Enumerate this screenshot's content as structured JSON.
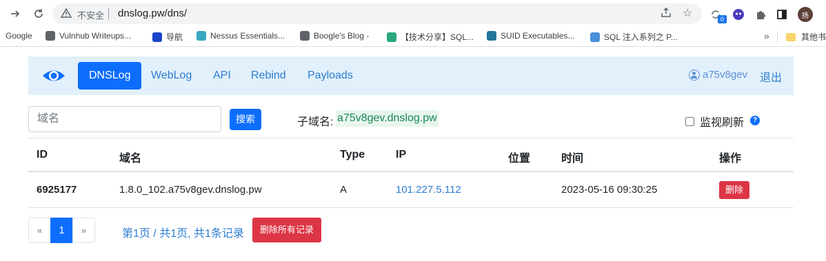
{
  "browser": {
    "security_label": "不安全",
    "url": "dnslog.pw/dns/",
    "extension_badge": "0",
    "profile_initial": "扬"
  },
  "bookmarks": [
    {
      "label": "Google",
      "icon": "none",
      "color": "#ffffff"
    },
    {
      "label": "Vulnhub Writeups...",
      "icon": "globe-icon",
      "color": "#5f6368"
    },
    {
      "label": "导航",
      "icon": "shield-icon",
      "color": "#1a45c9"
    },
    {
      "label": "Nessus Essentials...",
      "icon": "nessus-icon",
      "color": "#3aa8c1"
    },
    {
      "label": "Boogle's Blog -",
      "icon": "bolt-icon",
      "color": "#5f6368"
    },
    {
      "label": "【技术分享】SQL...",
      "icon": "e-icon",
      "color": "#2aa87c"
    },
    {
      "label": "SUID Executables...",
      "icon": "wordpress-icon",
      "color": "#21759b"
    },
    {
      "label": "SQL 注入系列之 P...",
      "icon": "layers-icon",
      "color": "#4a90d9"
    }
  ],
  "bookmarks_more": "»",
  "bookmarks_folder": "其他书",
  "nav": {
    "items": [
      "DNSLog",
      "WebLog",
      "API",
      "Rebind",
      "Payloads"
    ],
    "active": "DNSLog",
    "username": "a75v8gev",
    "logout": "退出"
  },
  "search": {
    "placeholder": "域名",
    "button": "搜索",
    "subdomain_label": "子域名:",
    "subdomain_value": "a75v8gev.dnslog.pw",
    "monitor_label": "监视刷新",
    "help": "?"
  },
  "table": {
    "headers": [
      "ID",
      "域名",
      "Type",
      "IP",
      "位置",
      "时间",
      "操作"
    ],
    "rows": [
      {
        "id": "6925177",
        "domain": "1.8.0_102.a75v8gev.dnslog.pw",
        "type": "A",
        "ip": "101.227.5.112",
        "location": "",
        "time": "2023-05-16 09:30:25",
        "action": "删除"
      }
    ]
  },
  "pagination": {
    "prev": "«",
    "current": "1",
    "next": "»",
    "info": "第1页 / 共1页, 共1条记录",
    "delete_all": "删除所有记录"
  },
  "colors": {
    "primary": "#0d6efd",
    "danger": "#dc3545",
    "navbar_bg": "#e1f0fa",
    "link": "#2c7cd1",
    "subdomain": "#198754"
  }
}
